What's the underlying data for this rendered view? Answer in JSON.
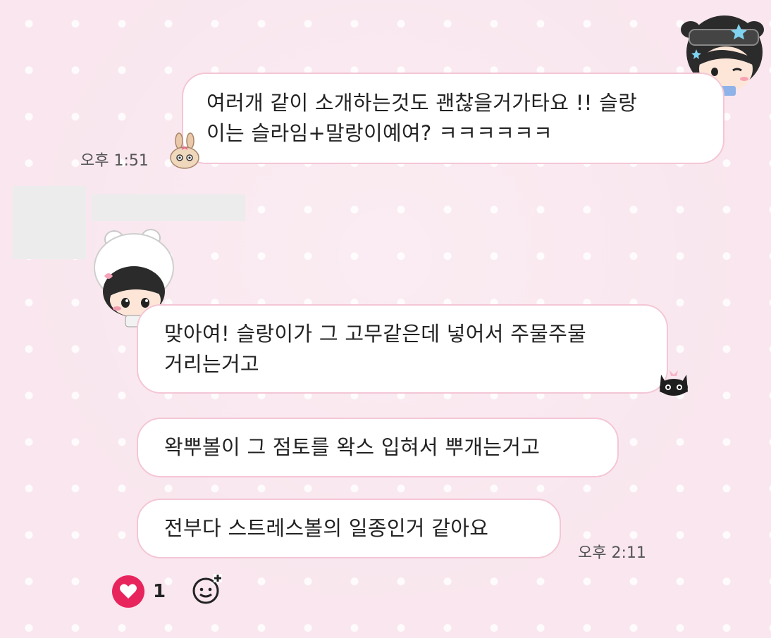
{
  "messages": [
    {
      "side": "right",
      "lines": [
        "여러개 같이 소개하는것도 괜찮을거가타요 !! 슬랑",
        "이는 슬라임+말랑이예여? ㅋㅋㅋㅋㅋㅋ"
      ],
      "time": "오후 1:51"
    },
    {
      "side": "left",
      "lines": [
        "맞아여! 슬랑이가 그 고무같은데 넣어서 주물주물",
        "거리는거고"
      ]
    },
    {
      "side": "left",
      "lines": [
        "왁뿌볼이 그 점토를 왁스 입혀서 뿌개는거고"
      ]
    },
    {
      "side": "left",
      "lines": [
        "전부다 스트레스볼의 일종인거 같아요"
      ],
      "time": "오후 2:11"
    }
  ],
  "reactions": {
    "like_count": "1",
    "like_icon": "heart-icon",
    "add_icon": "add-emoji-icon"
  },
  "colors": {
    "background": "#f9e6ee",
    "bubble_border": "#f4c6d6",
    "heart": "#e8245c"
  }
}
